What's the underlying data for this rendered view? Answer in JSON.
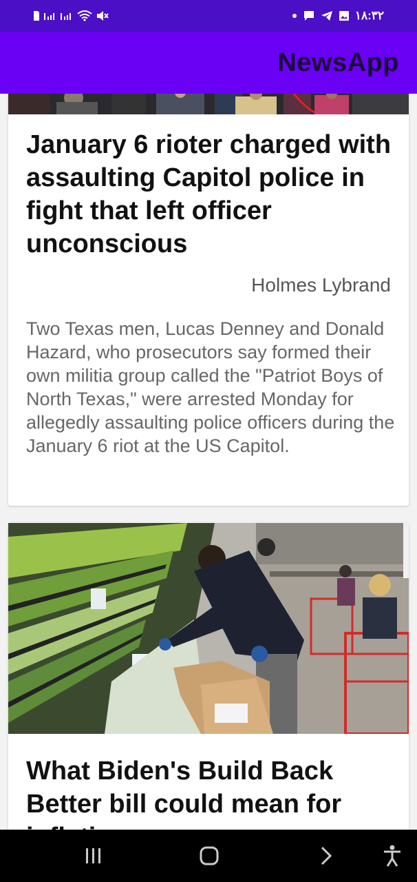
{
  "status_bar": {
    "time": "۱۸:۳۲",
    "left_icons": [
      "sim-card-icon",
      "signal-icon",
      "signal-icon",
      "wifi-icon",
      "mute-icon"
    ],
    "right_icons": [
      "dot-icon",
      "chat-icon",
      "telegram-icon",
      "image-icon"
    ]
  },
  "app_bar": {
    "title": "NewsApp"
  },
  "articles": [
    {
      "image": "crowd-photo",
      "title": "January 6 rioter charged with assaulting Capitol police in fight that left officer unconscious",
      "author": "Holmes Lybrand",
      "description": "Two Texas men, Lucas Denney and Donald Hazard, who prosecutors say formed their own militia group called the \"Patriot Boys of North Texas,\" were arrested Monday for allegedly assaulting police officers during the January 6 riot at the US Capitol."
    },
    {
      "image": "grocery-store-photo",
      "title": "What Biden's Build Back Better bill could mean for inflation"
    }
  ],
  "nav_bar": {
    "buttons": [
      "recent-apps-icon",
      "home-icon",
      "back-icon",
      "accessibility-icon"
    ]
  },
  "colors": {
    "status_bar": "#4b0fc6",
    "app_bar": "#6a00f4",
    "title_text": "#1a0a3a",
    "background": "#f2f2f2"
  }
}
